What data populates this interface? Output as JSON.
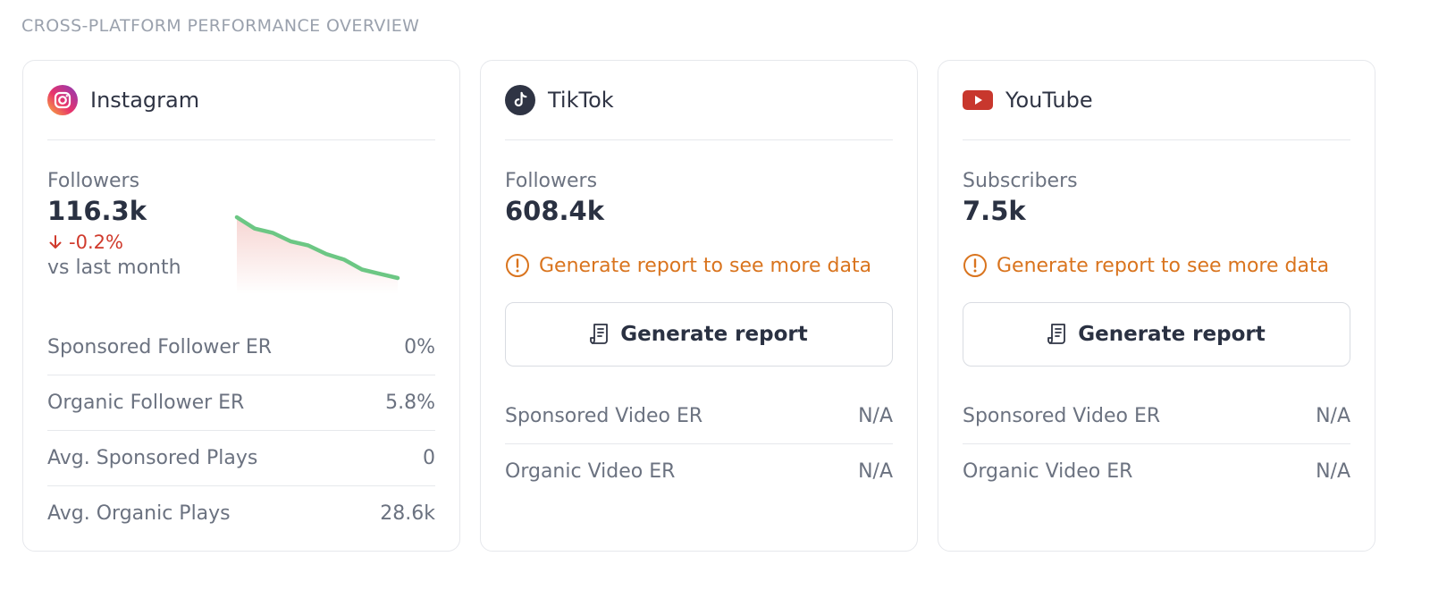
{
  "section_title": "CROSS-PLATFORM PERFORMANCE OVERVIEW",
  "colors": {
    "accent_negative": "#d03a2c",
    "warning": "#d9741e",
    "sparkline_line": "#6cc784",
    "sparkline_fill": "#f6d3d0",
    "youtube_red": "#c8372d"
  },
  "instagram": {
    "name": "Instagram",
    "icon": "instagram-icon",
    "metric_label": "Followers",
    "metric_value": "116.3k",
    "change": "-0.2%",
    "change_icon": "arrow-down-icon",
    "vs_text": "vs last month",
    "trend": [
      100,
      92,
      89,
      83,
      80,
      74,
      70,
      63,
      60,
      57
    ],
    "stats": [
      {
        "label": "Sponsored Follower ER",
        "value": "0%"
      },
      {
        "label": "Organic Follower ER",
        "value": "5.8%"
      },
      {
        "label": "Avg. Sponsored Plays",
        "value": "0"
      },
      {
        "label": "Avg. Organic Plays",
        "value": "28.6k"
      }
    ]
  },
  "tiktok": {
    "name": "TikTok",
    "icon": "tiktok-icon",
    "metric_label": "Followers",
    "metric_value": "608.4k",
    "notice": "Generate report to see more data",
    "button_label": "Generate report",
    "stats": [
      {
        "label": "Sponsored Video ER",
        "value": "N/A"
      },
      {
        "label": "Organic Video ER",
        "value": "N/A"
      }
    ]
  },
  "youtube": {
    "name": "YouTube",
    "icon": "youtube-icon",
    "metric_label": "Subscribers",
    "metric_value": "7.5k",
    "notice": "Generate report to see more data",
    "button_label": "Generate report",
    "stats": [
      {
        "label": "Sponsored Video ER",
        "value": "N/A"
      },
      {
        "label": "Organic Video ER",
        "value": "N/A"
      }
    ]
  }
}
